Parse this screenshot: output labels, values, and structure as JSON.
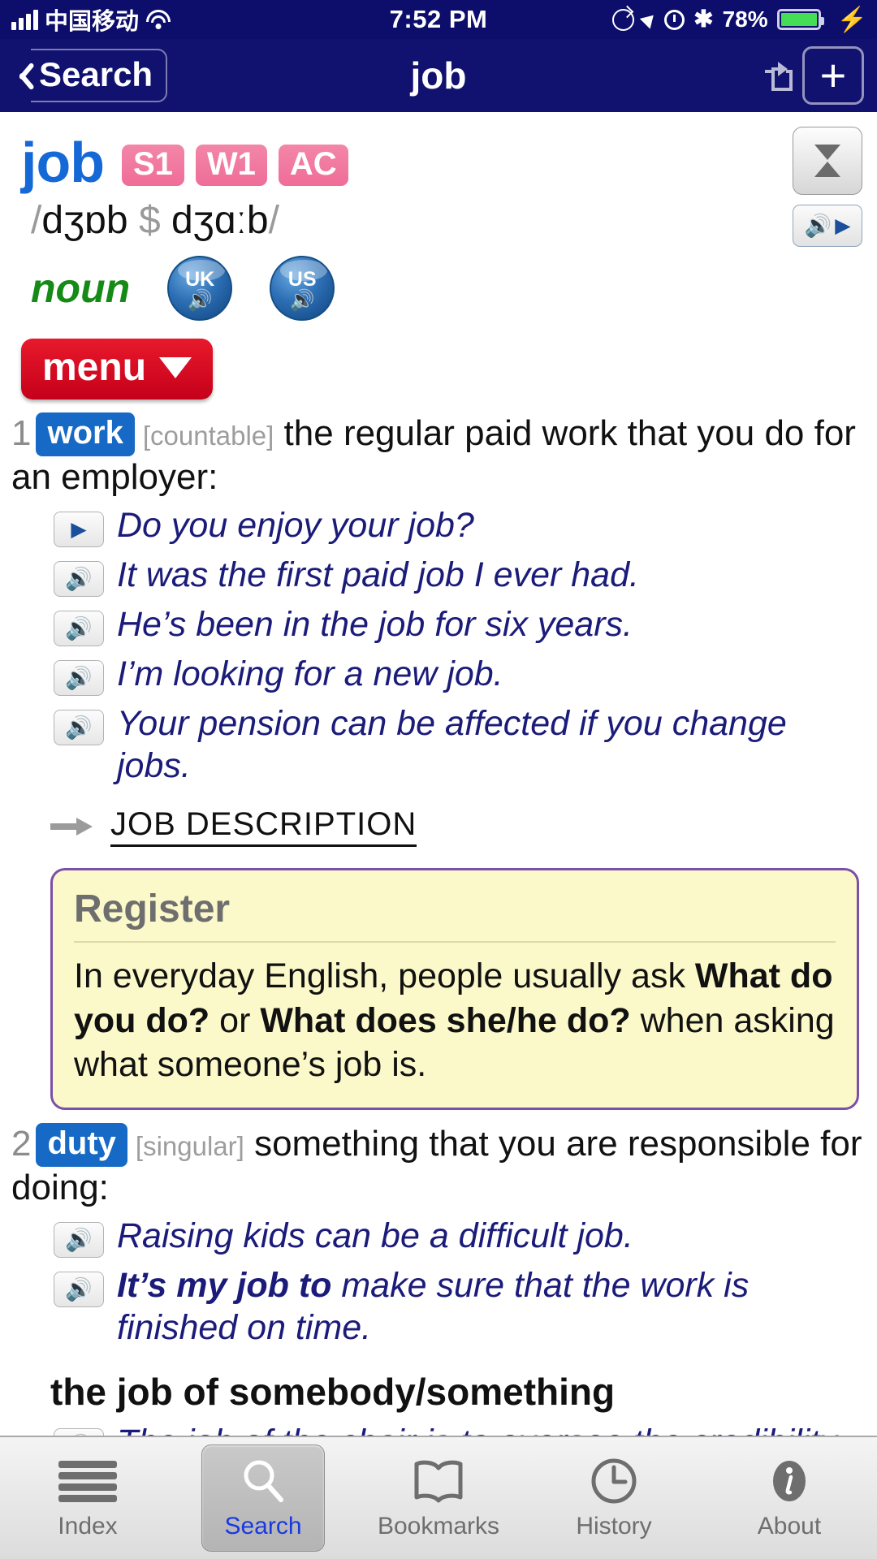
{
  "status_bar": {
    "carrier": "中国移动",
    "time": "7:52 PM",
    "battery_percent": "78%",
    "icons": [
      "signal-bars",
      "wifi-icon",
      "rotation-lock-icon",
      "location-arrow-icon",
      "alarm-icon",
      "bluetooth-icon",
      "battery-icon",
      "charging-bolt-icon"
    ],
    "bluetooth_glyph": "✱"
  },
  "nav_bar": {
    "back_label": "Search",
    "title": "job",
    "share_icon": "share-icon",
    "add_label": "+"
  },
  "entry": {
    "headword": "job",
    "badges": [
      "S1",
      "W1",
      "AC"
    ],
    "pronunciation": {
      "open_slash": "/",
      "uk": "dʒɒb",
      "separator": "$",
      "us": "dʒɑːb",
      "close_slash": "/"
    },
    "part_of_speech": "noun",
    "audio_buttons": [
      {
        "label": "UK",
        "glyph": "🔊"
      },
      {
        "label": "US",
        "glyph": "🔊"
      }
    ],
    "menu_label": "menu",
    "menu_caret": "▼"
  },
  "senses": [
    {
      "number": "1",
      "tag": "work",
      "grammar": "[countable]",
      "definition": "the regular paid work that you do for an employer:",
      "examples": [
        {
          "icon": "play-icon",
          "text": "Do you enjoy your job?"
        },
        {
          "icon": "speaker-icon",
          "text": "It was the first paid job I ever had."
        },
        {
          "icon": "speaker-icon",
          "text": "He’s been in the job for six years."
        },
        {
          "icon": "speaker-icon",
          "text": "I’m looking for a new job."
        },
        {
          "icon": "speaker-icon",
          "text": "Your pension can be affected if you change jobs."
        }
      ],
      "cross_reference": "JOB DESCRIPTION",
      "register": {
        "title": "Register",
        "text_parts": [
          {
            "text": "In everyday English, people usually ask ",
            "bold": false
          },
          {
            "text": "What do you do?",
            "bold": true
          },
          {
            "text": " or ",
            "bold": false
          },
          {
            "text": "What does she/he do?",
            "bold": true
          },
          {
            "text": " when asking what someone’s job is.",
            "bold": false
          }
        ]
      }
    },
    {
      "number": "2",
      "tag": "duty",
      "grammar": "[singular]",
      "definition": "something that you are responsible for doing:",
      "examples": [
        {
          "icon": "speaker-icon",
          "text": "Raising kids can be a difficult job."
        },
        {
          "icon": "speaker-icon",
          "bold_lead": "It’s my job to",
          "text": " make sure that the work is finished on time."
        }
      ]
    }
  ],
  "phrase_heading": "the job of somebody/something",
  "cut_off_example": "The job of the chair is to oversee the credibility of",
  "side_controls": {
    "scroll_jump_icon": "up-down-arrows-icon",
    "play_all_icon": "speaker-play-icon"
  },
  "tab_bar": {
    "items": [
      {
        "label": "Index",
        "icon": "hamburger-icon",
        "selected": false
      },
      {
        "label": "Search",
        "icon": "search-icon",
        "selected": true
      },
      {
        "label": "Bookmarks",
        "icon": "book-icon",
        "selected": false
      },
      {
        "label": "History",
        "icon": "clock-icon",
        "selected": false
      },
      {
        "label": "About",
        "icon": "info-icon",
        "selected": false
      }
    ]
  },
  "colors": {
    "nav_bg": "#111170",
    "headword": "#1569d6",
    "badge_pink": "#ef6d98",
    "sense_tag_blue": "#1669c4",
    "pos_green": "#168a16",
    "menu_red": "#d4001d",
    "example_navy": "#1b1b7a",
    "register_bg": "#fbf8c9",
    "register_border": "#7c4fa8",
    "tab_selected": "#1a39e0"
  }
}
